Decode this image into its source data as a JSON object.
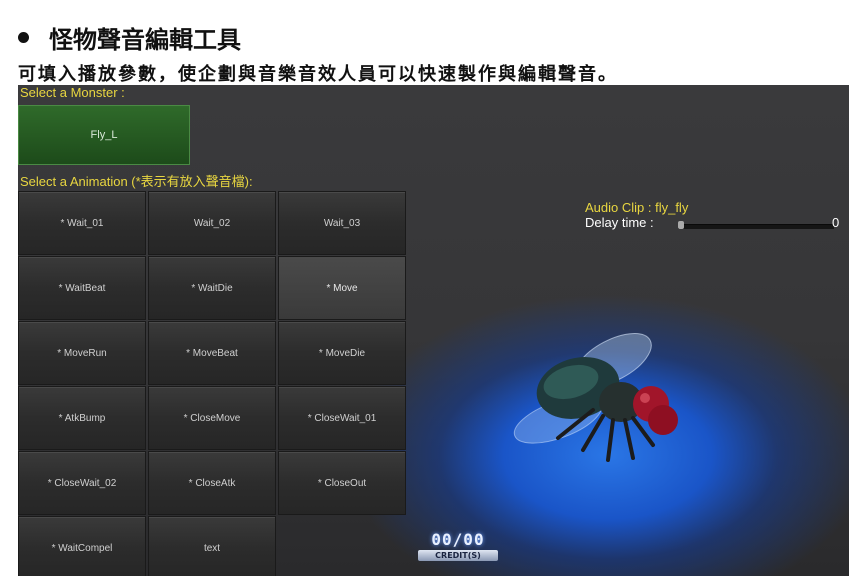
{
  "heading": "怪物聲音編輯工具",
  "subtitle": "可填入播放參數，使企劃與音樂音效人員可以快速製作與編輯聲音。",
  "game": {
    "select_monster_label": "Select a Monster :",
    "monster_button": "Fly_L",
    "select_animation_label": "Select a Animation (*表示有放入聲音檔):",
    "animations": [
      "* Wait_01",
      "Wait_02",
      "Wait_03",
      "* WaitBeat",
      "* WaitDie",
      "* Move",
      "* MoveRun",
      "* MoveBeat",
      "* MoveDie",
      "* AtkBump",
      "* CloseMove",
      "* CloseWait_01",
      "* CloseWait_02",
      "* CloseAtk",
      "* CloseOut",
      "* WaitCompel",
      "text"
    ],
    "selected_animation": "* Move",
    "audio_clip": "Audio Clip : fly_fly",
    "delay_label": "Delay time :",
    "delay_value": "0",
    "credit_count": "00/00",
    "credit_label": "CREDIT(S)"
  },
  "icons": [
    "bullet-icon",
    "fly-monster-icon"
  ],
  "colors": {
    "label_yellow": "#e8d640",
    "monster_green": "#2f6a2a",
    "glow_blue": "#2a76e6"
  }
}
